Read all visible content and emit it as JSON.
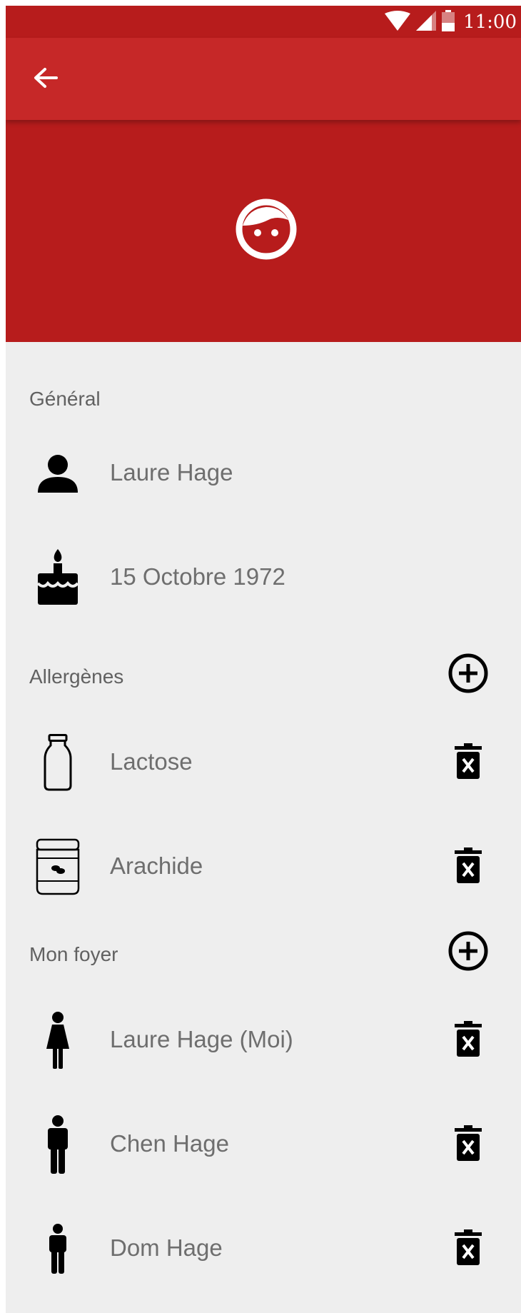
{
  "status_bar": {
    "time": "11:00"
  },
  "sections": {
    "general": {
      "title": "Général",
      "name": "Laure Hage",
      "birthdate": "15 Octobre 1972"
    },
    "allergens": {
      "title": "Allergènes",
      "items": [
        {
          "label": "Lactose",
          "icon": "milk-bottle-icon"
        },
        {
          "label": "Arachide",
          "icon": "peanut-jar-icon"
        }
      ]
    },
    "household": {
      "title": "Mon foyer",
      "members": [
        {
          "label": "Laure Hage (Moi)",
          "icon": "woman-icon"
        },
        {
          "label": "Chen Hage",
          "icon": "man-icon"
        },
        {
          "label": "Dom Hage",
          "icon": "child-icon"
        }
      ]
    }
  },
  "colors": {
    "status_bar": "#b71c1c",
    "app_bar": "#c62828",
    "hero": "#b71c1c",
    "background": "#eeeeee"
  }
}
